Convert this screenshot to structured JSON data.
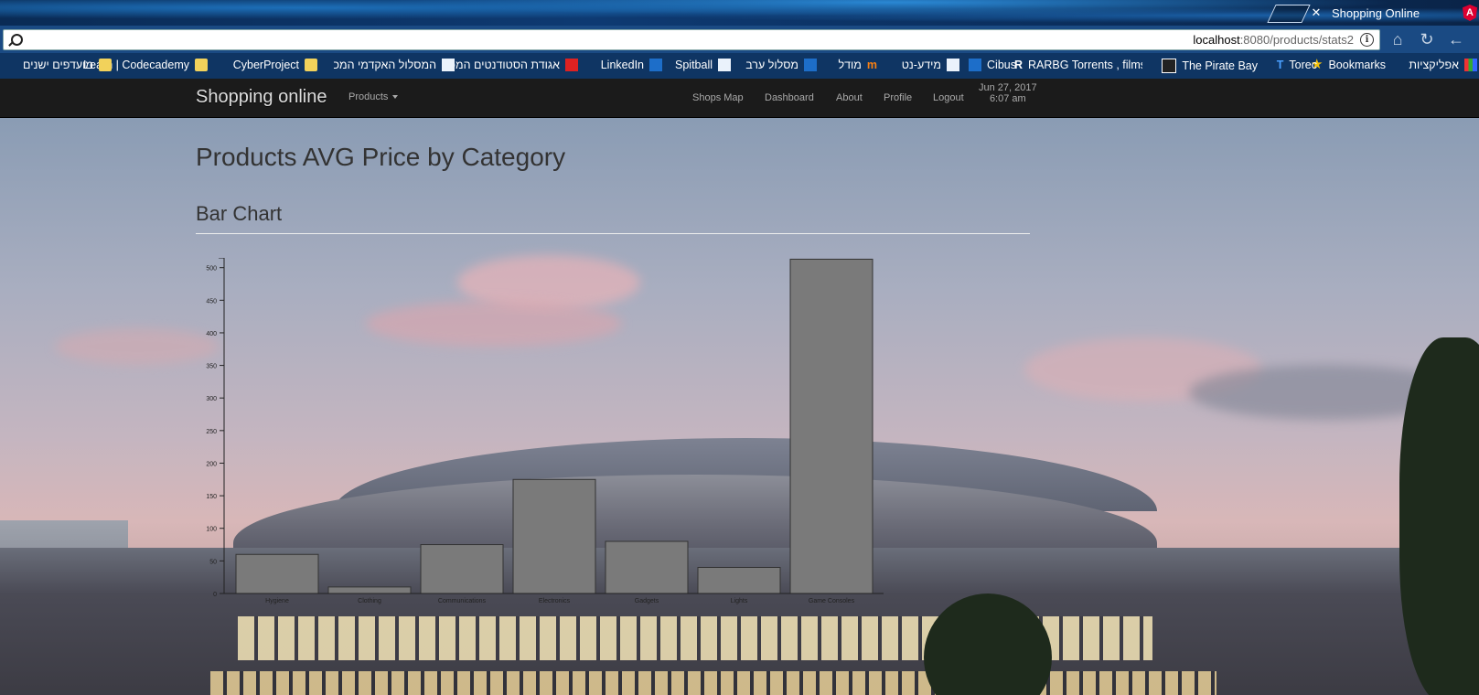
{
  "browser": {
    "tab_title": "Shopping Online",
    "tab_close": "✕",
    "tab_icon": "angular-icon",
    "url_host": "localhost",
    "url_path": ":8080/products/stats2",
    "bookmarks": [
      {
        "label": "אפליקציות",
        "icon": "apps-icon"
      },
      {
        "label": "Bookmarks",
        "icon": "star-icon"
      },
      {
        "label": "Torec",
        "icon": "torec-icon"
      },
      {
        "label": "The Pirate Bay",
        "icon": "pirate-bay-icon"
      },
      {
        "label": "RARBG Torrents , films",
        "icon": "rarbg-icon"
      },
      {
        "label": "Cibus",
        "icon": "cibus-icon"
      },
      {
        "label": "מידע-נט",
        "icon": "site-icon"
      },
      {
        "label": "מודל",
        "icon": "moodle-icon"
      },
      {
        "label": "מסלול ערב",
        "icon": "site-icon"
      },
      {
        "label": "Spitball",
        "icon": "spitball-icon"
      },
      {
        "label": "LinkedIn",
        "icon": "linkedin-icon"
      },
      {
        "label": "אגודת הסטודנטים המכ",
        "icon": "site-icon"
      },
      {
        "label": "המסלול האקדמי המכ",
        "icon": "site-icon"
      },
      {
        "label": "CyberProject",
        "icon": "folder-icon"
      },
      {
        "label": "Learn | Codecademy",
        "icon": "folder-icon"
      },
      {
        "label": "מועדפים ישנים",
        "icon": "folder-icon"
      }
    ]
  },
  "navbar": {
    "brand": "Shopping online",
    "products_menu": "Products",
    "links": [
      "Shops Map",
      "Dashboard",
      "About",
      "Profile",
      "Logout"
    ],
    "date": "Jun 27, 2017",
    "time": "6:07 am"
  },
  "page": {
    "title": "Products AVG Price by Category",
    "section": "Bar Chart"
  },
  "chart_data": {
    "type": "bar",
    "title": "",
    "xlabel": "",
    "ylabel": "",
    "categories": [
      "Hygiene",
      "Clothing",
      "Communications",
      "Electronics",
      "Gadgets",
      "Lights",
      "Game Consoles"
    ],
    "values": [
      60,
      10,
      75,
      175,
      80,
      40,
      513
    ],
    "ylim": [
      0,
      515
    ],
    "yticks": [
      0,
      50,
      100,
      150,
      200,
      250,
      300,
      350,
      400,
      450,
      500
    ],
    "grid": false,
    "bar_color": "#7a7a7a"
  }
}
